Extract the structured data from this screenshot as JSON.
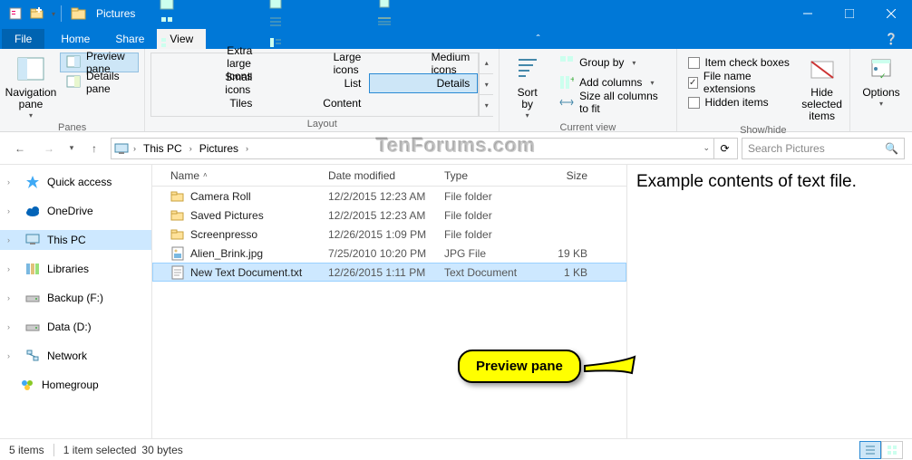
{
  "window": {
    "title": "Pictures"
  },
  "tabs": {
    "file": "File",
    "home": "Home",
    "share": "Share",
    "view": "View"
  },
  "ribbon": {
    "panes": {
      "navigation": "Navigation\npane",
      "preview": "Preview pane",
      "details": "Details pane",
      "group": "Panes"
    },
    "layout": {
      "xl": "Extra large icons",
      "l": "Large icons",
      "m": "Medium icons",
      "s": "Small icons",
      "list": "List",
      "det": "Details",
      "tiles": "Tiles",
      "content": "Content",
      "group": "Layout"
    },
    "view": {
      "sort": "Sort\nby",
      "groupby": "Group by",
      "addcols": "Add columns",
      "sizeall": "Size all columns to fit",
      "group": "Current view"
    },
    "showhide": {
      "itemcheck": "Item check boxes",
      "ext": "File name extensions",
      "hidden": "Hidden items",
      "hidesel": "Hide selected\nitems",
      "group": "Show/hide"
    },
    "options": "Options"
  },
  "breadcrumb": {
    "thispc": "This PC",
    "pictures": "Pictures"
  },
  "search": {
    "placeholder": "Search Pictures"
  },
  "nav": {
    "quick": "Quick access",
    "onedrive": "OneDrive",
    "thispc": "This PC",
    "libraries": "Libraries",
    "backup": "Backup (F:)",
    "data": "Data (D:)",
    "network": "Network",
    "homegroup": "Homegroup"
  },
  "columns": {
    "name": "Name",
    "date": "Date modified",
    "type": "Type",
    "size": "Size"
  },
  "rows": [
    {
      "name": "Camera Roll",
      "date": "12/2/2015 12:23 AM",
      "type": "File folder",
      "size": "",
      "icon": "folder"
    },
    {
      "name": "Saved Pictures",
      "date": "12/2/2015 12:23 AM",
      "type": "File folder",
      "size": "",
      "icon": "folder"
    },
    {
      "name": "Screenpresso",
      "date": "12/26/2015 1:09 PM",
      "type": "File folder",
      "size": "",
      "icon": "folder"
    },
    {
      "name": "Alien_Brink.jpg",
      "date": "7/25/2010 10:20 PM",
      "type": "JPG File",
      "size": "19 KB",
      "icon": "jpg"
    },
    {
      "name": "New Text Document.txt",
      "date": "12/26/2015 1:11 PM",
      "type": "Text Document",
      "size": "1 KB",
      "icon": "txt",
      "selected": true
    }
  ],
  "preview": "Example contents of text file.",
  "status": {
    "count": "5 items",
    "sel": "1 item selected",
    "bytes": "30 bytes"
  },
  "callout": "Preview pane",
  "watermark": "TenForums.com"
}
